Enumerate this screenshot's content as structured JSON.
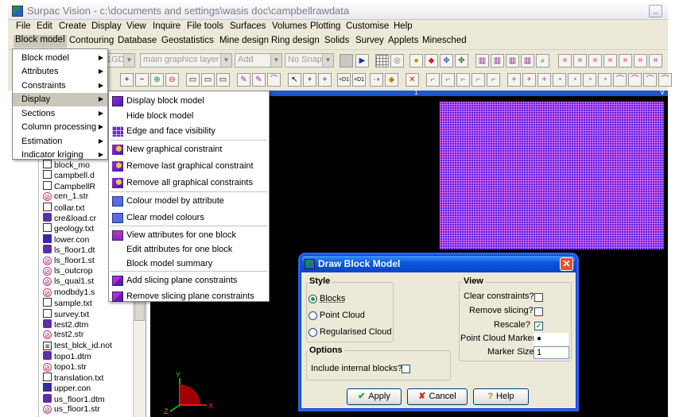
{
  "window": {
    "title": "Surpac Vision - c:\\documents and settings\\wasis doc\\campbellrawdata",
    "minimize_glyph": "_"
  },
  "menubar": {
    "row1": [
      "File",
      "Edit",
      "Create",
      "Display",
      "View",
      "Inquire",
      "File tools",
      "Surfaces",
      "Volumes",
      "Plotting",
      "Customise",
      "Help"
    ],
    "row2": [
      "Block model",
      "Contouring",
      "Database",
      "Geostatistics",
      "Mine design",
      "Ring design",
      "Solids",
      "Survey",
      "Applets",
      "Minesched"
    ]
  },
  "toolbar": {
    "combo1": "1GD",
    "layer_combo": "main graphics layer",
    "mode_combo": "Add",
    "snap_combo": "No Snap"
  },
  "block_model_menu": [
    {
      "label": "Block model",
      "has_submenu": true,
      "selected": false
    },
    {
      "label": "Attributes",
      "has_submenu": true,
      "selected": false
    },
    {
      "label": "Constraints",
      "has_submenu": true,
      "selected": false
    },
    {
      "label": "Display",
      "has_submenu": true,
      "selected": true
    },
    {
      "label": "Sections",
      "has_submenu": true,
      "selected": false
    },
    {
      "label": "Column processing",
      "has_submenu": true,
      "selected": false
    },
    {
      "label": "Estimation",
      "has_submenu": true,
      "selected": false
    },
    {
      "label": "Indicator kriging",
      "has_submenu": true,
      "selected": false
    }
  ],
  "display_submenu": [
    {
      "label": "Display block model",
      "icon": "block-model-icon"
    },
    {
      "label": "Hide block model",
      "icon": ""
    },
    {
      "label": "Edge and face visibility",
      "icon": "grid-icon"
    },
    {
      "label": "New graphical constraint",
      "icon": "constraint-icon"
    },
    {
      "label": "Remove last graphical constraint",
      "icon": "constraint-icon"
    },
    {
      "label": "Remove all graphical constraints",
      "icon": "constraint-icon"
    },
    {
      "label": "Colour model by attribute",
      "icon": "colour-icon"
    },
    {
      "label": "Clear model colours",
      "icon": "colour-icon"
    },
    {
      "label": "View attributes for one block",
      "icon": "attribute-icon"
    },
    {
      "label": "Edit attributes for one block",
      "icon": ""
    },
    {
      "label": "Block model summary",
      "icon": ""
    },
    {
      "label": "Add slicing plane constraints",
      "icon": "slice-icon"
    },
    {
      "label": "Remove slicing plane constraints",
      "icon": "slice-icon"
    }
  ],
  "file_tree": [
    {
      "name": "block_mo",
      "type": "txt"
    },
    {
      "name": "campbell.d",
      "type": "txt"
    },
    {
      "name": "CampbellR",
      "type": "txt"
    },
    {
      "name": "cen_1.str",
      "type": "str"
    },
    {
      "name": "collar.txt",
      "type": "txt"
    },
    {
      "name": "cre&load.cr",
      "type": "dtm"
    },
    {
      "name": "geology.txt",
      "type": "txt"
    },
    {
      "name": "lower.con",
      "type": "con"
    },
    {
      "name": "ls_floor1.dt",
      "type": "dtm"
    },
    {
      "name": "ls_floor1.st",
      "type": "str"
    },
    {
      "name": "ls_outcrop",
      "type": "str"
    },
    {
      "name": "ls_qual1.st",
      "type": "str"
    },
    {
      "name": "modbdy1.s",
      "type": "str"
    },
    {
      "name": "sample.txt",
      "type": "txt"
    },
    {
      "name": "survey.txt",
      "type": "txt"
    },
    {
      "name": "test2.dtm",
      "type": "dtm"
    },
    {
      "name": "test2.str",
      "type": "str"
    },
    {
      "name": "test_blck_id.not",
      "type": "not"
    },
    {
      "name": "topo1.dtm",
      "type": "dtm"
    },
    {
      "name": "topo1.str",
      "type": "str"
    },
    {
      "name": "translation.txt",
      "type": "txt"
    },
    {
      "name": "upper.con",
      "type": "con"
    },
    {
      "name": "us_floor1.dtm",
      "type": "dtm"
    },
    {
      "name": "us_floor1.str",
      "type": "str"
    }
  ],
  "graphics": {
    "header_marker": "1",
    "header_right": "∇"
  },
  "dialog": {
    "title": "Draw Block Model",
    "style": {
      "label": "Style",
      "options": [
        "Blocks",
        "Point Cloud",
        "Regularised Cloud"
      ],
      "selected": "Blocks"
    },
    "options_group": {
      "label": "Options",
      "include_internal_blocks": "Include internal blocks?"
    },
    "view": {
      "label": "View",
      "clear_constraints": "Clear constraints?",
      "remove_slicing": "Remove slicing?",
      "rescale": "Rescale?",
      "rescale_checked": true,
      "point_cloud_marker_label": "Point Cloud Marker",
      "point_cloud_marker_value": "●",
      "marker_size_label": "Marker Size",
      "marker_size_value": "1"
    },
    "buttons": {
      "apply": "Apply",
      "cancel": "Cancel",
      "help": "Help"
    },
    "close_glyph": "✕"
  },
  "axes": {
    "y": "Y",
    "z": "Z",
    "x": "X"
  },
  "colors": {
    "block_model": "#5a1fd6",
    "graphics_bg": "#000000",
    "dialog_title": "#0a58e0",
    "menu_highlight": "#c9c6ba"
  }
}
